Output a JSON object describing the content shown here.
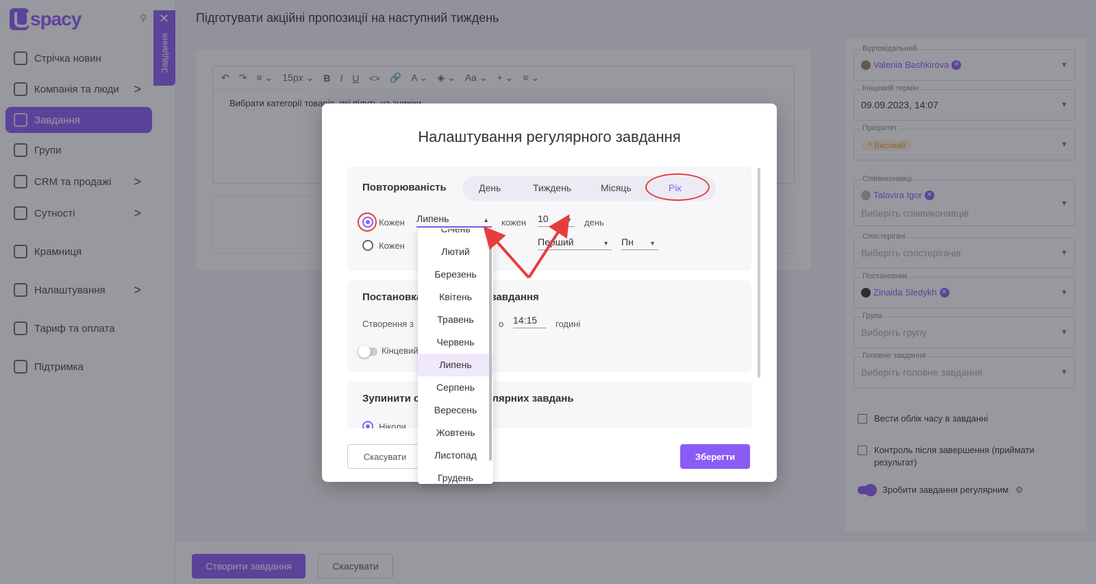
{
  "app": {
    "logo": "spacy",
    "tab_label": "Завдання"
  },
  "sidebar": {
    "items": [
      {
        "label": "Стрічка новин",
        "icon": "home-icon"
      },
      {
        "label": "Компанія та люди",
        "icon": "building-icon",
        "chevron": ">"
      },
      {
        "label": "Завдання",
        "icon": "tasks-icon"
      },
      {
        "label": "Групи",
        "icon": "users-icon"
      },
      {
        "label": "CRM та продажі",
        "icon": "funnel-icon",
        "chevron": ">"
      },
      {
        "label": "Сутності",
        "icon": "entity-icon",
        "chevron": ">"
      },
      {
        "label": "Крамниця",
        "icon": "store-icon"
      },
      {
        "label": "Налаштування",
        "icon": "gear-icon",
        "chevron": ">"
      },
      {
        "label": "Тариф та оплата",
        "icon": "card-icon"
      },
      {
        "label": "Підтримка",
        "icon": "support-icon"
      }
    ]
  },
  "page": {
    "title": "Підготувати акційні пропозиції на наступний тиждень"
  },
  "editor": {
    "toolbar": [
      "↶",
      "↷",
      "≡ ⌄",
      "15px ⌄",
      "B",
      "I",
      "U",
      "<>",
      "🔗",
      "A ⌄",
      "◈ ⌄",
      "Aa ⌄",
      "+ ⌄",
      "≡ ⌄"
    ],
    "body": "Вибрати категорії товарів, які підуть на знижки"
  },
  "fields": [
    {
      "label": "Відповідальний",
      "chip": "Valeriia Bashkirova"
    },
    {
      "label": "Кінцевий термін",
      "value": "09.09.2023, 14:07"
    },
    {
      "label": "Пріоритет",
      "badge": "^ Високий"
    },
    {
      "label": "Співвиконавці",
      "chip": "Talavira Igor",
      "placeholder": "Виберіть співвиконавців"
    },
    {
      "label": "Спостерігачі",
      "placeholder": "Виберіть спостерігачів"
    },
    {
      "label": "Постановник",
      "chip": "Zinaida Sledykh"
    },
    {
      "label": "Група",
      "placeholder": "Виберіть групу"
    },
    {
      "label": "Головне завдання",
      "placeholder": "Виберіть головне завдання"
    }
  ],
  "options": {
    "time_tracking": "Вести облік часу в завданні",
    "control": "Контроль після завершення (приймати результат)",
    "regular": "Зробити завдання регулярним"
  },
  "footer": {
    "create": "Створити завдання",
    "cancel": "Скасувати"
  },
  "modal": {
    "title": "Налаштування регулярного завдання",
    "repeat": {
      "heading": "Повторюваність",
      "segments": [
        "День",
        "Тиждень",
        "Місяць",
        "Рік"
      ],
      "selected_segment": "Рік",
      "row1": {
        "label": "Кожен",
        "month": "Липень",
        "every": "кожен",
        "day": "10",
        "day_word": "день"
      },
      "row2": {
        "label": "Кожен",
        "ordinal": "Перший",
        "weekday": "Пн"
      }
    },
    "setup": {
      "heading": "Постановка регулярного завдання",
      "create_label": "Створення з",
      "at": "о",
      "time": "14:15",
      "hours": "годині",
      "deadline": "Кінцевий"
    },
    "stop": {
      "heading": "Зупинити створення регулярних завдань",
      "never": "Ніколи"
    },
    "cancel": "Скасувати",
    "save": "Зберегти",
    "months": [
      "Січень",
      "Лютий",
      "Березень",
      "Квітень",
      "Травень",
      "Червень",
      "Липень",
      "Серпень",
      "Вересень",
      "Жовтень",
      "Листопад",
      "Грудень"
    ],
    "selected_month": "Липень"
  },
  "colors": {
    "accent": "#8a5cf6",
    "annotation": "#e53e3e"
  }
}
